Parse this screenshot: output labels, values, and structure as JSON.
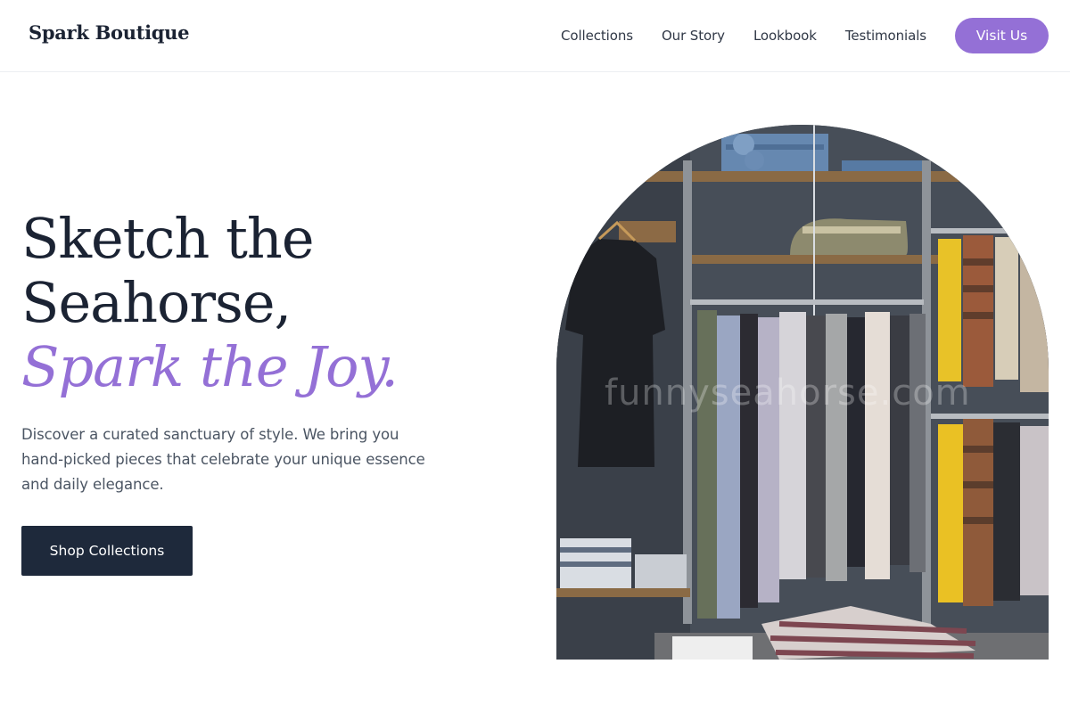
{
  "header": {
    "brand": "Spark Boutique",
    "nav": [
      "Collections",
      "Our Story",
      "Lookbook",
      "Testimonials"
    ],
    "cta_label": "Visit Us"
  },
  "hero": {
    "title_line1": "Sketch the",
    "title_line2": "Seahorse,",
    "title_accent": "Spark the Joy.",
    "description": "Discover a curated sanctuary of style. We bring you hand-picked pieces that celebrate your unique essence and daily elegance.",
    "button_label": "Shop Collections",
    "image_watermark": "funnyseahorse.com"
  },
  "colors": {
    "accent": "#9470d6",
    "dark": "#1e293b",
    "text_muted": "#4b5563"
  }
}
